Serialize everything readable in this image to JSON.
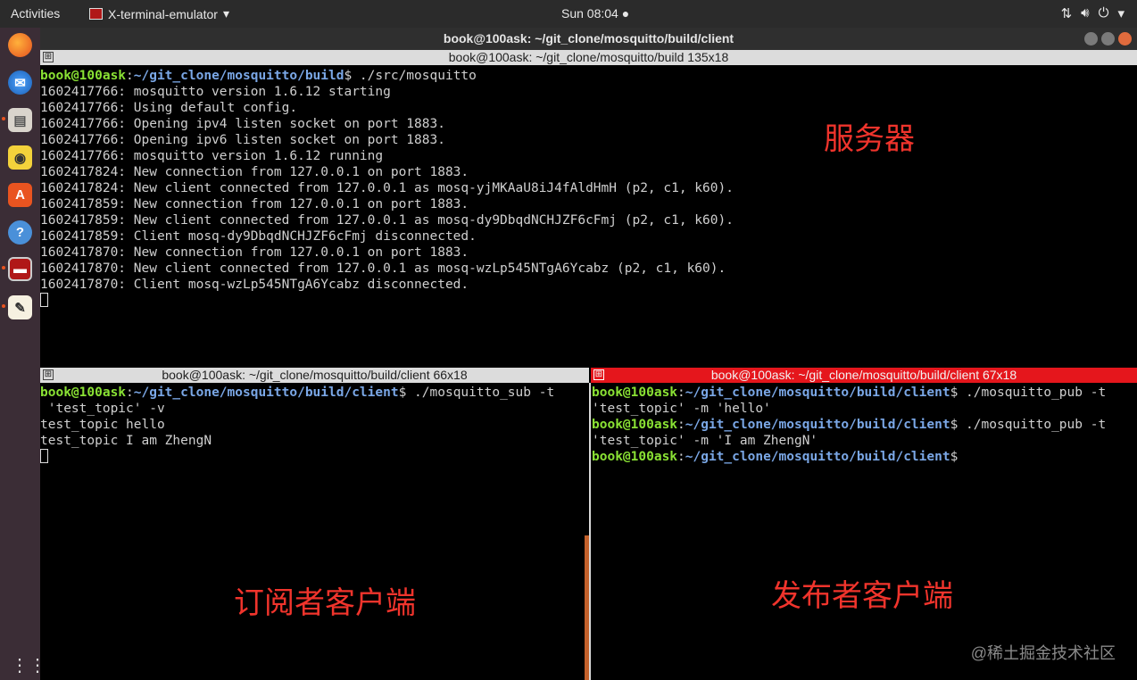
{
  "topbar": {
    "activities": "Activities",
    "app_name": "X-terminal-emulator",
    "clock": "Sun 08:04"
  },
  "window": {
    "title": "book@100ask: ~/git_clone/mosquitto/build/client"
  },
  "panes": {
    "server": {
      "title": "book@100ask: ~/git_clone/mosquitto/build 135x18",
      "prompt": {
        "user": "book@100ask",
        "path": "~/git_clone/mosquitto/build",
        "cmd": " ./src/mosquitto"
      },
      "lines": [
        "1602417766: mosquitto version 1.6.12 starting",
        "1602417766: Using default config.",
        "1602417766: Opening ipv4 listen socket on port 1883.",
        "1602417766: Opening ipv6 listen socket on port 1883.",
        "1602417766: mosquitto version 1.6.12 running",
        "1602417824: New connection from 127.0.0.1 on port 1883.",
        "1602417824: New client connected from 127.0.0.1 as mosq-yjMKAaU8iJ4fAldHmH (p2, c1, k60).",
        "1602417859: New connection from 127.0.0.1 on port 1883.",
        "1602417859: New client connected from 127.0.0.1 as mosq-dy9DbqdNCHJZF6cFmj (p2, c1, k60).",
        "1602417859: Client mosq-dy9DbqdNCHJZF6cFmj disconnected.",
        "1602417870: New connection from 127.0.0.1 on port 1883.",
        "1602417870: New client connected from 127.0.0.1 as mosq-wzLp545NTgA6Ycabz (p2, c1, k60).",
        "1602417870: Client mosq-wzLp545NTgA6Ycabz disconnected."
      ],
      "annotation": "服务器"
    },
    "subscriber": {
      "title": "book@100ask: ~/git_clone/mosquitto/build/client 66x18",
      "prompt": {
        "user": "book@100ask",
        "path": "~/git_clone/mosquitto/build/client",
        "cmd": " ./mosquitto_sub -t"
      },
      "lines": [
        " 'test_topic' -v",
        "test_topic hello",
        "test_topic I am ZhengN"
      ],
      "annotation": "订阅者客户端"
    },
    "publisher": {
      "title": "book@100ask: ~/git_clone/mosquitto/build/client 67x18",
      "prompts": [
        {
          "user": "book@100ask",
          "path": "~/git_clone/mosquitto/build/client",
          "cmd": " ./mosquitto_pub -t",
          "cont": "'test_topic' -m 'hello'"
        },
        {
          "user": "book@100ask",
          "path": "~/git_clone/mosquitto/build/client",
          "cmd": " ./mosquitto_pub -t",
          "cont": "'test_topic' -m 'I am ZhengN'"
        },
        {
          "user": "book@100ask",
          "path": "~/git_clone/mosquitto/build/client",
          "cmd": ""
        }
      ],
      "annotation": "发布者客户端"
    }
  },
  "watermark": "@稀土掘金技术社区",
  "colors": {
    "prompt_user": "#8ae234",
    "prompt_path": "#7aa7e6",
    "annotation": "#f0342c",
    "active_title": "#e5161c"
  }
}
